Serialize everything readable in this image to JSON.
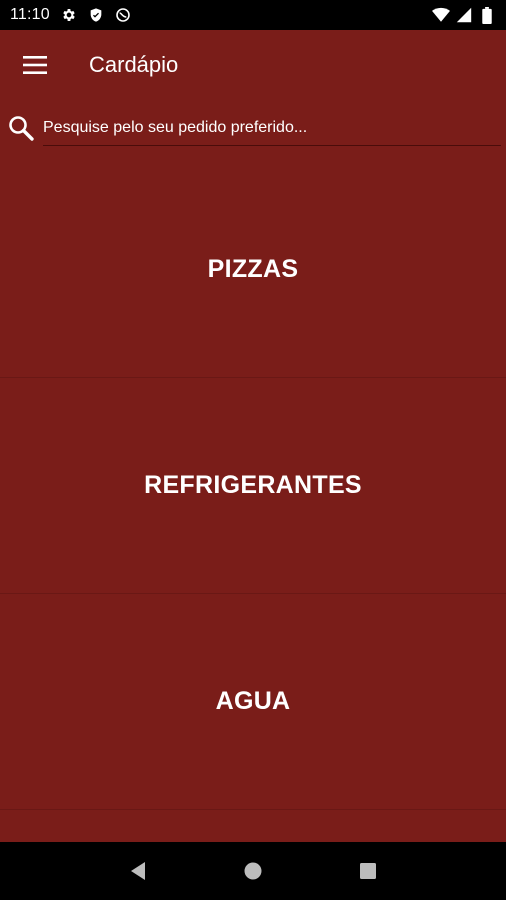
{
  "status_bar": {
    "time": "11:10",
    "left_icons": [
      "gear-icon",
      "shield-icon",
      "do-not-disturb-icon"
    ],
    "right_icons": [
      "wifi-icon",
      "signal-icon",
      "battery-icon"
    ]
  },
  "app_bar": {
    "title": "Cardápio",
    "menu_icon": "hamburger-menu-icon"
  },
  "search": {
    "placeholder": "Pesquise pelo seu pedido preferido...",
    "value": "",
    "icon": "search-icon"
  },
  "categories": [
    {
      "label": "PIZZAS"
    },
    {
      "label": "REFRIGERANTES"
    },
    {
      "label": "AGUA"
    }
  ],
  "nav_bar": {
    "buttons": [
      "back-icon",
      "home-icon",
      "recents-icon"
    ]
  },
  "colors": {
    "background": "#7a1d19",
    "text": "#ffffff",
    "divider": "#6a1815",
    "system_bars": "#000000"
  }
}
